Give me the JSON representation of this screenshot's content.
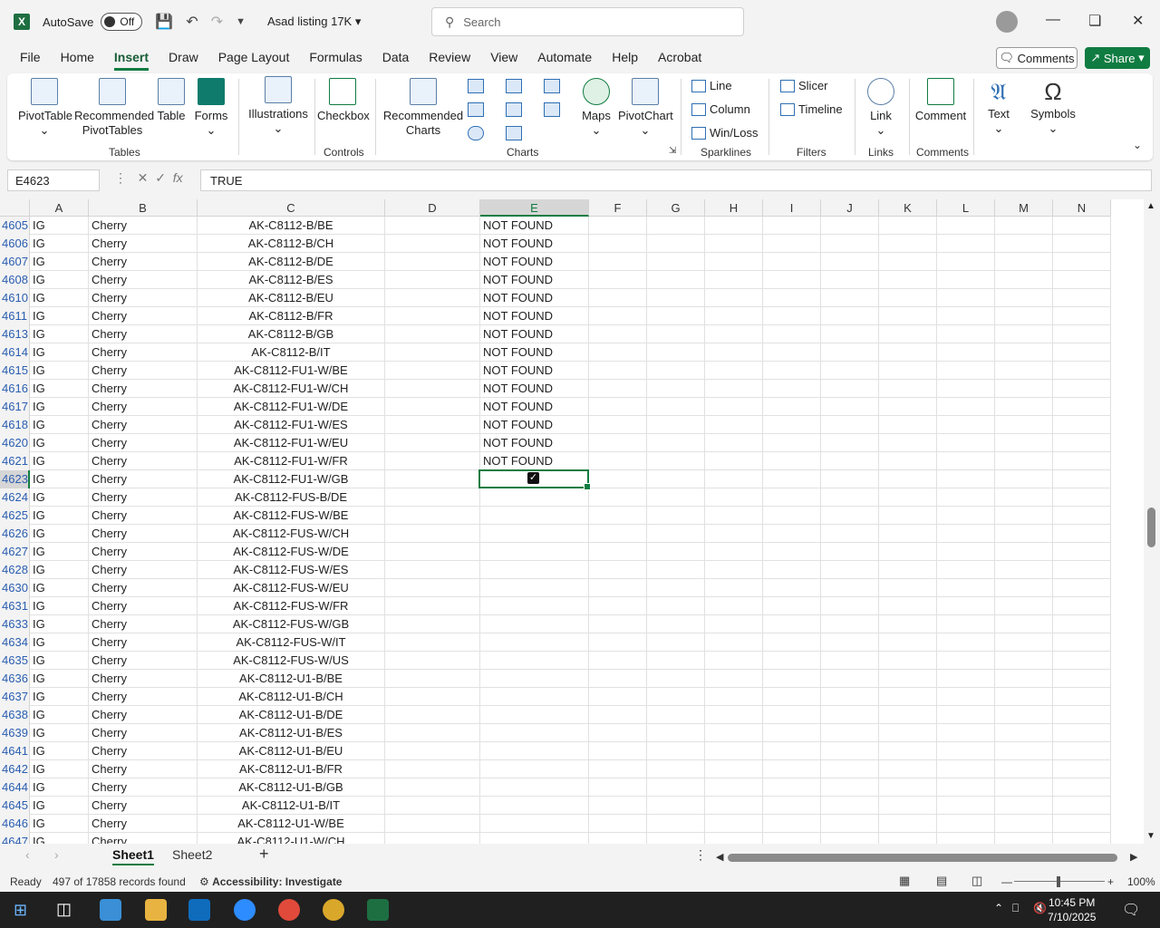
{
  "titlebar": {
    "app_icon": "X",
    "autosave_label": "AutoSave",
    "autosave_state": "Off",
    "doc_title": "Asad listing 17K ▾",
    "search_placeholder": "Search"
  },
  "menu": [
    "File",
    "Home",
    "Insert",
    "Draw",
    "Page Layout",
    "Formulas",
    "Data",
    "Review",
    "View",
    "Automate",
    "Help",
    "Acrobat"
  ],
  "menu_active": "Insert",
  "comments_label": "Comments",
  "share_label": "Share",
  "ribbon": {
    "pivottable": "PivotTable",
    "recommended_pivot": "Recommended",
    "recommended_pivot2": "PivotTables",
    "table": "Table",
    "forms": "Forms",
    "illustrations": "Illustrations",
    "checkbox": "Checkbox",
    "recommended_charts": "Recommended",
    "recommended_charts2": "Charts",
    "maps": "Maps",
    "pivotchart": "PivotChart",
    "line": "Line",
    "column": "Column",
    "winloss": "Win/Loss",
    "slicer": "Slicer",
    "timeline": "Timeline",
    "link": "Link",
    "comment": "Comment",
    "text": "Text",
    "symbols": "Symbols",
    "groups": {
      "tables": "Tables",
      "controls": "Controls",
      "charts": "Charts",
      "sparklines": "Sparklines",
      "filters": "Filters",
      "links": "Links",
      "comments": "Comments"
    }
  },
  "namebox": "E4623",
  "formula": "TRUE",
  "columns": [
    "A",
    "B",
    "C",
    "D",
    "E",
    "F",
    "G",
    "H",
    "I",
    "J",
    "K",
    "L",
    "M",
    "N"
  ],
  "selected_column": "E",
  "selected_row": "4623",
  "rows": [
    {
      "n": "4605",
      "a": "IG",
      "b": "Cherry",
      "c": "AK-C8112-B/BE",
      "e": "NOT FOUND"
    },
    {
      "n": "4606",
      "a": "IG",
      "b": "Cherry",
      "c": "AK-C8112-B/CH",
      "e": "NOT FOUND"
    },
    {
      "n": "4607",
      "a": "IG",
      "b": "Cherry",
      "c": "AK-C8112-B/DE",
      "e": "NOT FOUND"
    },
    {
      "n": "4608",
      "a": "IG",
      "b": "Cherry",
      "c": "AK-C8112-B/ES",
      "e": "NOT FOUND"
    },
    {
      "n": "4610",
      "a": "IG",
      "b": "Cherry",
      "c": "AK-C8112-B/EU",
      "e": "NOT FOUND"
    },
    {
      "n": "4611",
      "a": "IG",
      "b": "Cherry",
      "c": "AK-C8112-B/FR",
      "e": "NOT FOUND"
    },
    {
      "n": "4613",
      "a": "IG",
      "b": "Cherry",
      "c": "AK-C8112-B/GB",
      "e": "NOT FOUND"
    },
    {
      "n": "4614",
      "a": "IG",
      "b": "Cherry",
      "c": "AK-C8112-B/IT",
      "e": "NOT FOUND"
    },
    {
      "n": "4615",
      "a": "IG",
      "b": "Cherry",
      "c": "AK-C8112-FU1-W/BE",
      "e": "NOT FOUND"
    },
    {
      "n": "4616",
      "a": "IG",
      "b": "Cherry",
      "c": "AK-C8112-FU1-W/CH",
      "e": "NOT FOUND"
    },
    {
      "n": "4617",
      "a": "IG",
      "b": "Cherry",
      "c": "AK-C8112-FU1-W/DE",
      "e": "NOT FOUND"
    },
    {
      "n": "4618",
      "a": "IG",
      "b": "Cherry",
      "c": "AK-C8112-FU1-W/ES",
      "e": "NOT FOUND"
    },
    {
      "n": "4620",
      "a": "IG",
      "b": "Cherry",
      "c": "AK-C8112-FU1-W/EU",
      "e": "NOT FOUND"
    },
    {
      "n": "4621",
      "a": "IG",
      "b": "Cherry",
      "c": "AK-C8112-FU1-W/FR",
      "e": "NOT FOUND"
    },
    {
      "n": "4623",
      "a": "IG",
      "b": "Cherry",
      "c": "AK-C8112-FU1-W/GB",
      "e": ""
    },
    {
      "n": "4624",
      "a": "IG",
      "b": "Cherry",
      "c": "AK-C8112-FUS-B/DE",
      "e": ""
    },
    {
      "n": "4625",
      "a": "IG",
      "b": "Cherry",
      "c": "AK-C8112-FUS-W/BE",
      "e": ""
    },
    {
      "n": "4626",
      "a": "IG",
      "b": "Cherry",
      "c": "AK-C8112-FUS-W/CH",
      "e": ""
    },
    {
      "n": "4627",
      "a": "IG",
      "b": "Cherry",
      "c": "AK-C8112-FUS-W/DE",
      "e": ""
    },
    {
      "n": "4628",
      "a": "IG",
      "b": "Cherry",
      "c": "AK-C8112-FUS-W/ES",
      "e": ""
    },
    {
      "n": "4630",
      "a": "IG",
      "b": "Cherry",
      "c": "AK-C8112-FUS-W/EU",
      "e": ""
    },
    {
      "n": "4631",
      "a": "IG",
      "b": "Cherry",
      "c": "AK-C8112-FUS-W/FR",
      "e": ""
    },
    {
      "n": "4633",
      "a": "IG",
      "b": "Cherry",
      "c": "AK-C8112-FUS-W/GB",
      "e": ""
    },
    {
      "n": "4634",
      "a": "IG",
      "b": "Cherry",
      "c": "AK-C8112-FUS-W/IT",
      "e": ""
    },
    {
      "n": "4635",
      "a": "IG",
      "b": "Cherry",
      "c": "AK-C8112-FUS-W/US",
      "e": ""
    },
    {
      "n": "4636",
      "a": "IG",
      "b": "Cherry",
      "c": "AK-C8112-U1-B/BE",
      "e": ""
    },
    {
      "n": "4637",
      "a": "IG",
      "b": "Cherry",
      "c": "AK-C8112-U1-B/CH",
      "e": ""
    },
    {
      "n": "4638",
      "a": "IG",
      "b": "Cherry",
      "c": "AK-C8112-U1-B/DE",
      "e": ""
    },
    {
      "n": "4639",
      "a": "IG",
      "b": "Cherry",
      "c": "AK-C8112-U1-B/ES",
      "e": ""
    },
    {
      "n": "4641",
      "a": "IG",
      "b": "Cherry",
      "c": "AK-C8112-U1-B/EU",
      "e": ""
    },
    {
      "n": "4642",
      "a": "IG",
      "b": "Cherry",
      "c": "AK-C8112-U1-B/FR",
      "e": ""
    },
    {
      "n": "4644",
      "a": "IG",
      "b": "Cherry",
      "c": "AK-C8112-U1-B/GB",
      "e": ""
    },
    {
      "n": "4645",
      "a": "IG",
      "b": "Cherry",
      "c": "AK-C8112-U1-B/IT",
      "e": ""
    },
    {
      "n": "4646",
      "a": "IG",
      "b": "Cherry",
      "c": "AK-C8112-U1-W/BE",
      "e": ""
    },
    {
      "n": "4647",
      "a": "IG",
      "b": "Cherry",
      "c": "AK-C8112-U1-W/CH",
      "e": ""
    }
  ],
  "sheets": [
    "Sheet1",
    "Sheet2"
  ],
  "status": {
    "ready": "Ready",
    "records": "497 of 17858 records found",
    "accessibility": "Accessibility: Investigate",
    "zoom": "100%"
  },
  "taskbar": {
    "time": "10:45 PM",
    "date": "7/10/2025"
  },
  "colors": {
    "accent": "#107c41",
    "rownum": "#2a5db0"
  }
}
